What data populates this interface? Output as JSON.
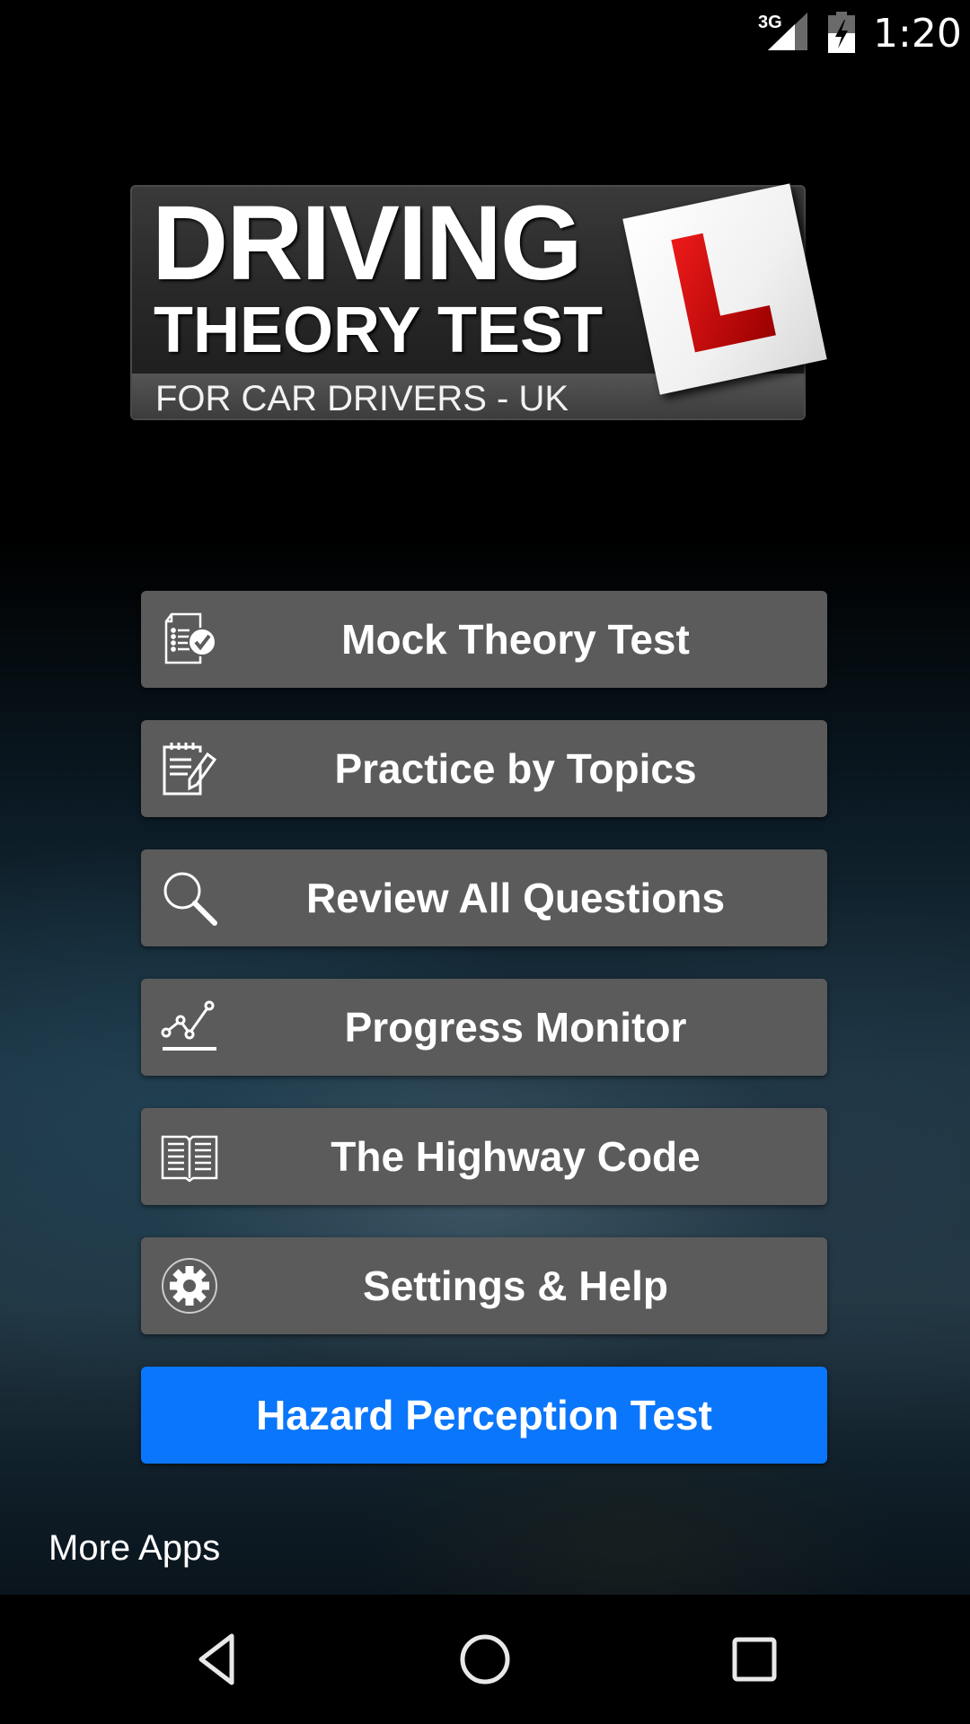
{
  "status_bar": {
    "network_type": "3G",
    "time": "1:20",
    "signal_icon": "cell-signal-icon",
    "battery_icon": "battery-charging-icon"
  },
  "logo": {
    "line1": "DRIVING",
    "line2": "THEORY TEST",
    "subtitle": "FOR CAR DRIVERS - UK",
    "plate_letter": "L",
    "plate_color": "#d40000"
  },
  "menu": {
    "items": [
      {
        "label": "Mock Theory Test",
        "icon": "checklist-document-icon"
      },
      {
        "label": "Practice by Topics",
        "icon": "notepad-pencil-icon"
      },
      {
        "label": "Review All Questions",
        "icon": "magnifier-icon"
      },
      {
        "label": "Progress Monitor",
        "icon": "line-chart-icon"
      },
      {
        "label": "The Highway Code",
        "icon": "open-book-icon"
      },
      {
        "label": "Settings & Help",
        "icon": "gear-icon"
      }
    ],
    "primary": {
      "label": "Hazard Perception Test",
      "color": "#0a76fb"
    }
  },
  "footer": {
    "more_apps": "More Apps"
  },
  "nav_bar": {
    "back": "back-icon",
    "home": "home-icon",
    "recents": "recents-icon"
  }
}
